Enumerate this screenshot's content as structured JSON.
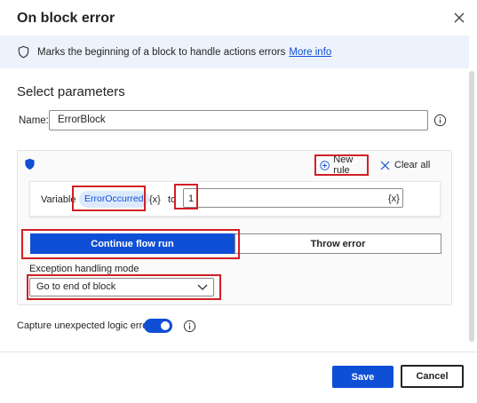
{
  "dialog": {
    "title": "On block error",
    "close_icon": "close-icon"
  },
  "info_bar": {
    "icon": "shield-icon",
    "text": "Marks the beginning of a block to handle actions errors",
    "link": "More info"
  },
  "section": {
    "title": "Select parameters"
  },
  "name_field": {
    "label": "Name:",
    "value": "ErrorBlock",
    "info_icon": "info-icon"
  },
  "rules_panel": {
    "icon": "shield-icon",
    "new_rule_label": "New rule",
    "clear_all_label": "Clear all",
    "rule": {
      "variable_label": "Variable",
      "variable_value": "ErrorOccurred",
      "variable_x": "{x}",
      "to_label": "to",
      "to_value": "1",
      "to_x": "{x}"
    },
    "mode_buttons": {
      "continue": "Continue flow run",
      "throw": "Throw error",
      "selected": "continue"
    },
    "exception_label": "Exception handling mode",
    "exception_value": "Go to end of block"
  },
  "capture": {
    "label": "Capture unexpected logic errors",
    "enabled": true
  },
  "footer": {
    "save": "Save",
    "cancel": "Cancel"
  },
  "colors": {
    "accent": "#0f4fd6",
    "highlight": "#d21f26",
    "info_bg": "#edf3fc"
  }
}
